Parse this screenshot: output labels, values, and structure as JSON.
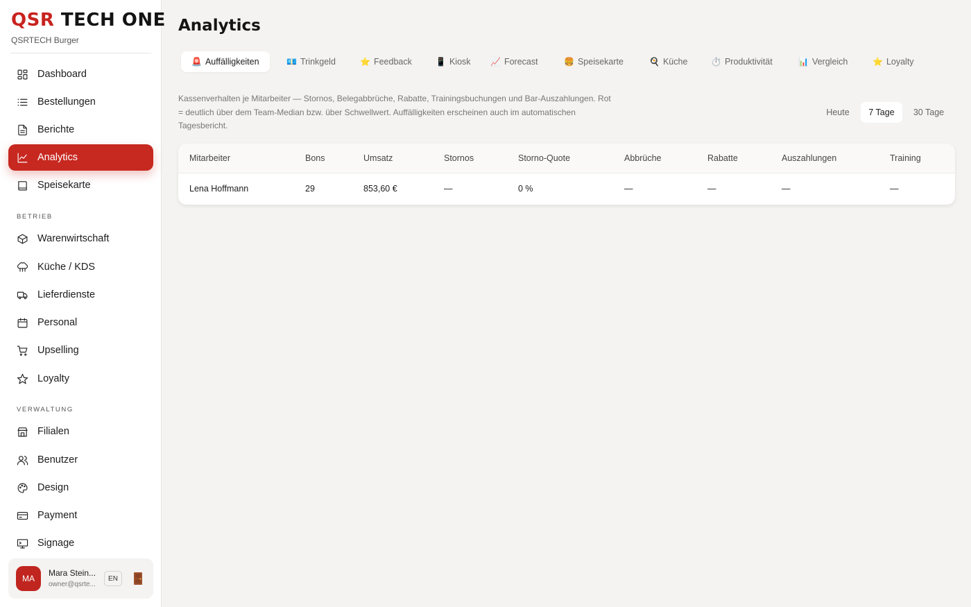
{
  "brand": {
    "part1": "QSR",
    "part2": "TECH ONE",
    "subtitle": "QSRTECH Burger"
  },
  "sidebar": {
    "main_items": [
      {
        "label": "Dashboard",
        "icon": "dashboard-icon"
      },
      {
        "label": "Bestellungen",
        "icon": "list-icon"
      },
      {
        "label": "Berichte",
        "icon": "document-icon"
      },
      {
        "label": "Analytics",
        "icon": "chart-icon",
        "active": true
      },
      {
        "label": "Speisekarte",
        "icon": "book-icon"
      }
    ],
    "section_betrieb": "BETRIEB",
    "betrieb_items": [
      {
        "label": "Warenwirtschaft",
        "icon": "box-icon"
      },
      {
        "label": "Küche / KDS",
        "icon": "chef-hat-icon"
      },
      {
        "label": "Lieferdienste",
        "icon": "truck-icon"
      },
      {
        "label": "Personal",
        "icon": "calendar-icon"
      },
      {
        "label": "Upselling",
        "icon": "cart-icon"
      },
      {
        "label": "Loyalty",
        "icon": "star-icon"
      }
    ],
    "section_verwaltung": "VERWALTUNG",
    "verwaltung_items": [
      {
        "label": "Filialen",
        "icon": "store-icon"
      },
      {
        "label": "Benutzer",
        "icon": "users-icon"
      },
      {
        "label": "Design",
        "icon": "palette-icon"
      },
      {
        "label": "Payment",
        "icon": "credit-card-icon"
      },
      {
        "label": "Signage",
        "icon": "monitor-icon"
      }
    ]
  },
  "user": {
    "initials": "MA",
    "name": "Mara Stein...",
    "email": "owner@qsrte...",
    "lang": "EN",
    "logout_icon": "door-icon"
  },
  "page": {
    "title": "Analytics"
  },
  "tabs": [
    {
      "emoji": "🚨",
      "label": "Auffälligkeiten",
      "active": true
    },
    {
      "emoji": "💶",
      "label": "Trinkgeld"
    },
    {
      "emoji": "⭐",
      "label": "Feedback"
    },
    {
      "emoji": "📱",
      "label": "Kiosk"
    },
    {
      "emoji": "📈",
      "label": "Forecast"
    },
    {
      "emoji": "🍔",
      "label": "Speisekarte"
    },
    {
      "emoji": "🍳",
      "label": "Küche"
    },
    {
      "emoji": "⏱️",
      "label": "Produktivität"
    },
    {
      "emoji": "📊",
      "label": "Vergleich"
    },
    {
      "emoji": "⭐",
      "label": "Loyalty"
    }
  ],
  "description_lines": [
    "Kassenverhalten je Mitarbeiter — Stornos, Belegabbrüche, Rabatte, Trainingsbuchungen und Bar-Auszahlungen. Rot",
    "= deutlich über dem Team-Median bzw. über Schwellwert. Auffälligkeiten erscheinen auch im automatischen",
    "Tagesbericht."
  ],
  "range": {
    "options": [
      "Heute",
      "7 Tage",
      "30 Tage"
    ],
    "selected": "7 Tage"
  },
  "table": {
    "columns": [
      "Mitarbeiter",
      "Bons",
      "Umsatz",
      "Stornos",
      "Storno-Quote",
      "Abbrüche",
      "Rabatte",
      "Auszahlungen",
      "Training"
    ],
    "rows": [
      [
        "Lena Hoffmann",
        "29",
        "853,60 €",
        "—",
        "0 %",
        "—",
        "—",
        "—",
        "—"
      ]
    ]
  },
  "colors": {
    "accent": "#c72820",
    "background": "#f4f3f1",
    "surface": "#ffffff"
  }
}
